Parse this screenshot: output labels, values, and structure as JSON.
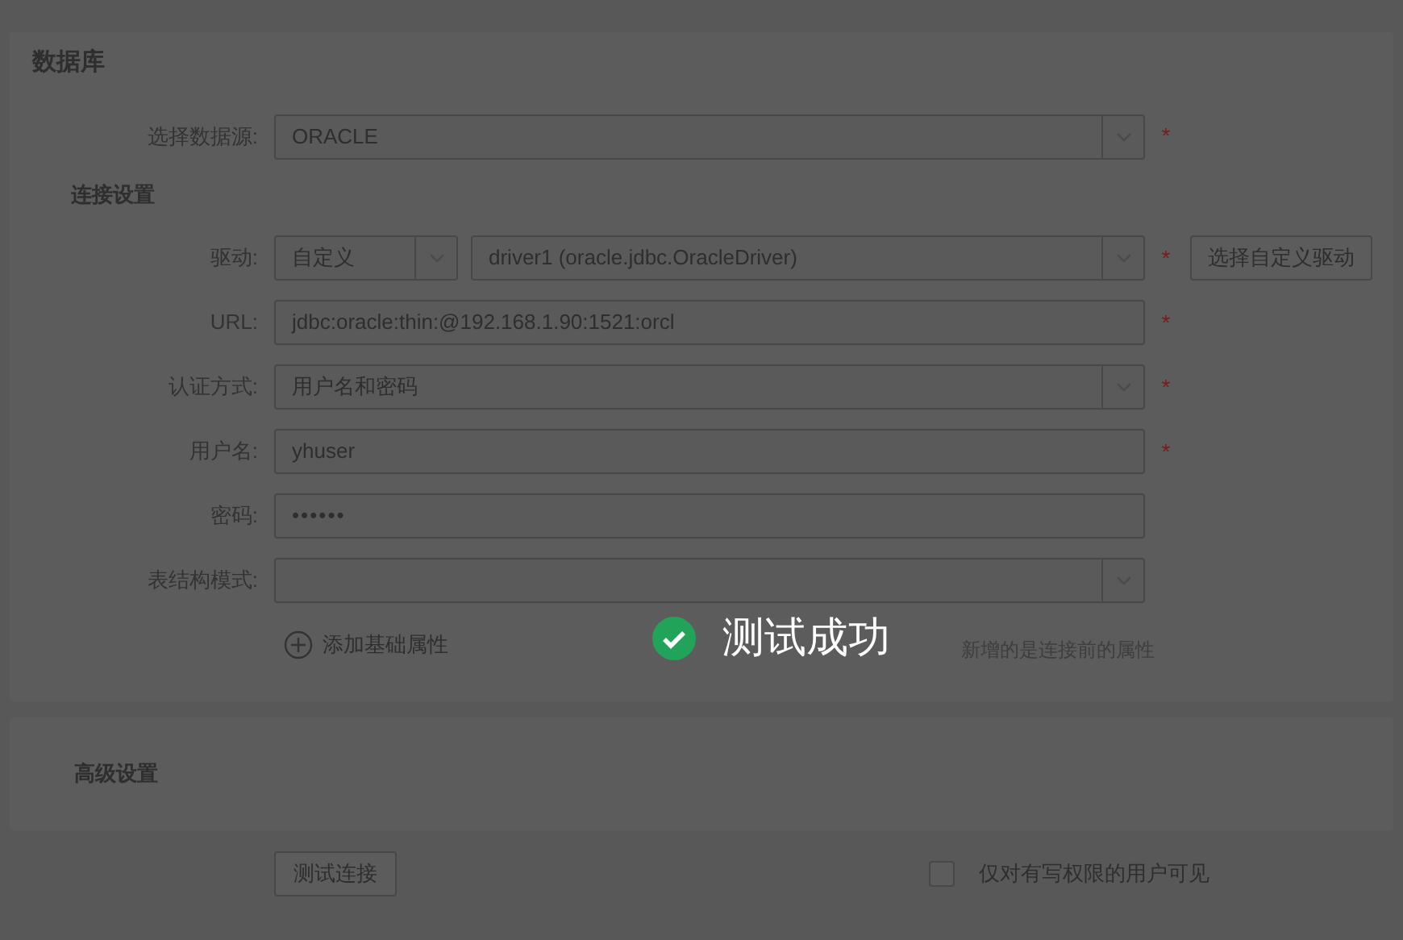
{
  "panel": {
    "title": "数据库"
  },
  "datasource": {
    "label": "选择数据源:",
    "value": "ORACLE",
    "required_mark": "*"
  },
  "connection": {
    "title": "连接设置",
    "rows": [
      {
        "kind": "driver",
        "label": "驱动:",
        "type_value": "自定义",
        "value": "driver1 (oracle.jdbc.OracleDriver)",
        "required_mark": "*",
        "button": "选择自定义驱动"
      },
      {
        "kind": "text",
        "label": "URL:",
        "value": "jdbc:oracle:thin:@192.168.1.90:1521:orcl",
        "required_mark": "*"
      },
      {
        "kind": "select",
        "label": "认证方式:",
        "value": "用户名和密码",
        "required_mark": "*"
      },
      {
        "kind": "text",
        "label": "用户名:",
        "value": "yhuser",
        "required_mark": "*"
      },
      {
        "kind": "password",
        "label": "密码:",
        "value": "••••••"
      },
      {
        "kind": "select",
        "label": "表结构模式:"
      }
    ]
  },
  "add_property": {
    "label": "添加基础属性",
    "hint": "新增的是连接前的属性"
  },
  "advanced": {
    "title": "高级设置"
  },
  "footer": {
    "test_button": "测试连接",
    "checkbox": {
      "label": "仅对有写权限的用户可见",
      "checked": false
    }
  },
  "toast": {
    "message": "测试成功"
  }
}
